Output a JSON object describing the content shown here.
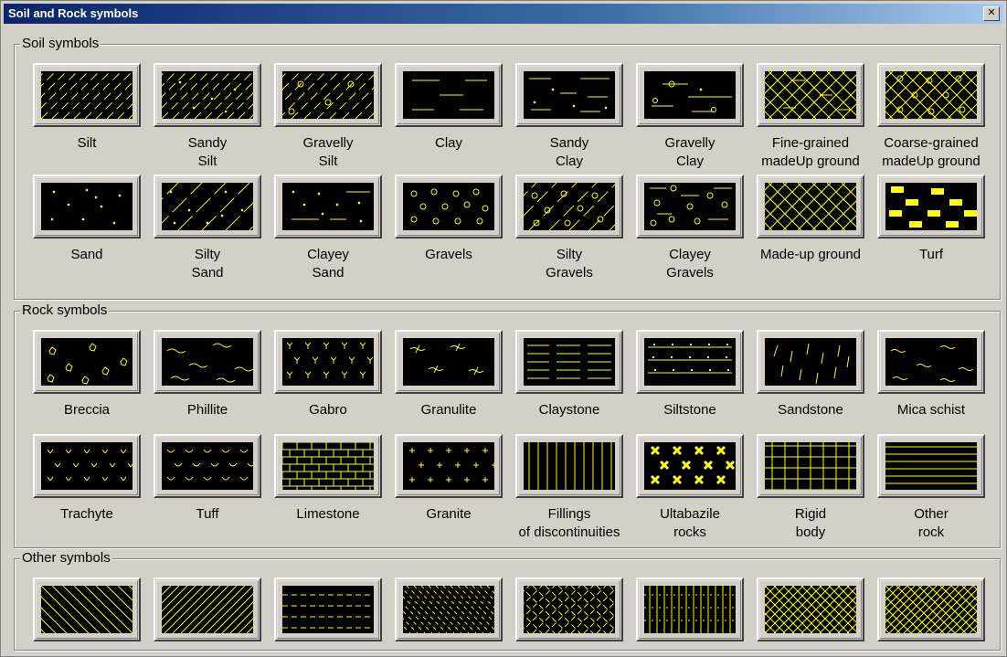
{
  "window": {
    "title": "Soil and Rock symbols",
    "close_label": "✕"
  },
  "colors": {
    "pattern": "#ffff00",
    "swatch_bg": "#000000",
    "titlebar": "#0a246a",
    "face": "#d4d0c8"
  },
  "soil": {
    "label": "Soil symbols",
    "items": [
      {
        "line1": "Silt",
        "line2": "",
        "pattern": "silt"
      },
      {
        "line1": "Sandy",
        "line2": "Silt",
        "pattern": "sandy-silt"
      },
      {
        "line1": "Gravelly",
        "line2": "Silt",
        "pattern": "gravelly-silt"
      },
      {
        "line1": "Clay",
        "line2": "",
        "pattern": "clay"
      },
      {
        "line1": "Sandy",
        "line2": "Clay",
        "pattern": "sandy-clay"
      },
      {
        "line1": "Gravelly",
        "line2": "Clay",
        "pattern": "gravelly-clay"
      },
      {
        "line1": "Fine-grained",
        "line2": "madeUp ground",
        "pattern": "fine-madeup"
      },
      {
        "line1": "Coarse-grained",
        "line2": "madeUp ground",
        "pattern": "coarse-madeup"
      },
      {
        "line1": "Sand",
        "line2": "",
        "pattern": "sand"
      },
      {
        "line1": "Silty",
        "line2": "Sand",
        "pattern": "silty-sand"
      },
      {
        "line1": "Clayey",
        "line2": "Sand",
        "pattern": "clayey-sand"
      },
      {
        "line1": "Gravels",
        "line2": "",
        "pattern": "gravels"
      },
      {
        "line1": "Silty",
        "line2": "Gravels",
        "pattern": "silty-gravels"
      },
      {
        "line1": "Clayey",
        "line2": "Gravels",
        "pattern": "clayey-gravels"
      },
      {
        "line1": "Made-up ground",
        "line2": "",
        "pattern": "madeup"
      },
      {
        "line1": "Turf",
        "line2": "",
        "pattern": "turf"
      }
    ]
  },
  "rock": {
    "label": "Rock symbols",
    "items": [
      {
        "line1": "Breccia",
        "line2": "",
        "pattern": "breccia"
      },
      {
        "line1": "Phillite",
        "line2": "",
        "pattern": "phillite"
      },
      {
        "line1": "Gabro",
        "line2": "",
        "pattern": "gabro"
      },
      {
        "line1": "Granulite",
        "line2": "",
        "pattern": "granulite"
      },
      {
        "line1": "Claystone",
        "line2": "",
        "pattern": "claystone"
      },
      {
        "line1": "Siltstone",
        "line2": "",
        "pattern": "siltstone"
      },
      {
        "line1": "Sandstone",
        "line2": "",
        "pattern": "sandstone"
      },
      {
        "line1": "Mica schist",
        "line2": "",
        "pattern": "mica-schist"
      },
      {
        "line1": "Trachyte",
        "line2": "",
        "pattern": "trachyte"
      },
      {
        "line1": "Tuff",
        "line2": "",
        "pattern": "tuff"
      },
      {
        "line1": "Limestone",
        "line2": "",
        "pattern": "limestone"
      },
      {
        "line1": "Granite",
        "line2": "",
        "pattern": "granite"
      },
      {
        "line1": "Fillings",
        "line2": "of discontinuities",
        "pattern": "fillings"
      },
      {
        "line1": "Ultabazile",
        "line2": "rocks",
        "pattern": "ultabazile"
      },
      {
        "line1": "Rigid",
        "line2": "body",
        "pattern": "rigid-body"
      },
      {
        "line1": "Other",
        "line2": "rock",
        "pattern": "other-rock"
      }
    ]
  },
  "other": {
    "label": "Other symbols",
    "items": [
      {
        "pattern": "diag-back"
      },
      {
        "pattern": "diag-forward"
      },
      {
        "pattern": "dashes"
      },
      {
        "pattern": "short-diag-dash"
      },
      {
        "pattern": "diamond-lattice"
      },
      {
        "pattern": "vertical-dense"
      },
      {
        "pattern": "cross-hatch"
      },
      {
        "pattern": "cross-hatch-2"
      }
    ]
  }
}
